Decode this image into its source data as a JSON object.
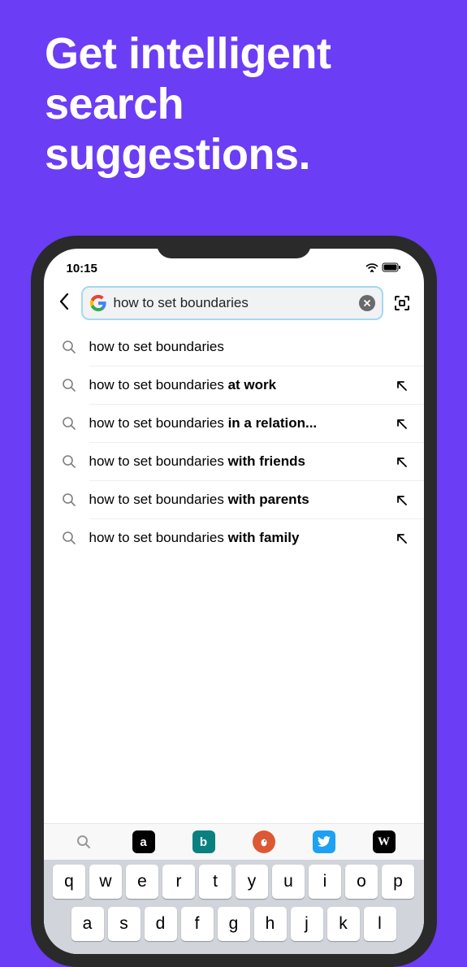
{
  "headline": "Get intelligent search suggestions.",
  "status": {
    "time": "10:15"
  },
  "search": {
    "query": "how to set boundaries"
  },
  "suggestions": [
    {
      "prefix": "how to set boundaries",
      "bold": "",
      "hasArrow": false
    },
    {
      "prefix": "how to set boundaries ",
      "bold": "at work",
      "hasArrow": true
    },
    {
      "prefix": "how to set boundaries ",
      "bold": "in a relation...",
      "hasArrow": true
    },
    {
      "prefix": "how to set boundaries ",
      "bold": "with friends",
      "hasArrow": true
    },
    {
      "prefix": "how to set boundaries ",
      "bold": "with parents",
      "hasArrow": true
    },
    {
      "prefix": "how to set boundaries ",
      "bold": "with family",
      "hasArrow": true
    }
  ],
  "shortcuts": [
    {
      "name": "search",
      "label": ""
    },
    {
      "name": "amazon",
      "label": "a"
    },
    {
      "name": "bing",
      "label": "b"
    },
    {
      "name": "duckduckgo",
      "label": ""
    },
    {
      "name": "twitter",
      "label": ""
    },
    {
      "name": "wikipedia",
      "label": "W"
    }
  ],
  "keyboard": {
    "row1": [
      "q",
      "w",
      "e",
      "r",
      "t",
      "y",
      "u",
      "i",
      "o",
      "p"
    ],
    "row2": [
      "a",
      "s",
      "d",
      "f",
      "g",
      "h",
      "j",
      "k",
      "l"
    ]
  }
}
